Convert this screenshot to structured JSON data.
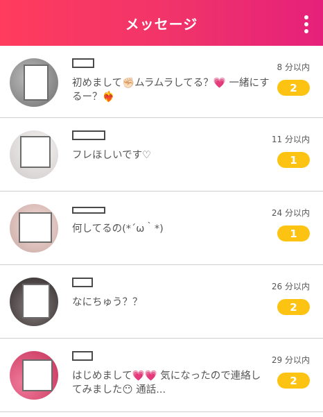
{
  "header": {
    "title": "メッセージ",
    "gradient_start": "#ff3c5e",
    "gradient_end": "#e5207b"
  },
  "badge_color": "#fdc312",
  "conversations": [
    {
      "time": "8 分以内",
      "unread": "2",
      "message": "初めまして✊🏻ムラムラしてる？💗 一緒にするー？❤️‍🔥",
      "avatar_bg": "#9c9c9c"
    },
    {
      "time": "11 分以内",
      "unread": "1",
      "message": "フレほしいです♡",
      "avatar_bg": "#e8e6e6"
    },
    {
      "time": "24 分以内",
      "unread": "1",
      "message": "何してるの(*´ω｀*)",
      "avatar_bg": "#e9cfcb"
    },
    {
      "time": "26 分以内",
      "unread": "2",
      "message": "なにちゅう？？",
      "avatar_bg": "#3a3434"
    },
    {
      "time": "29 分以内",
      "unread": "2",
      "message": "はじめまして💗💗 気になったので連絡してみました😶 通話...",
      "avatar_bg": "#e0557b"
    }
  ]
}
